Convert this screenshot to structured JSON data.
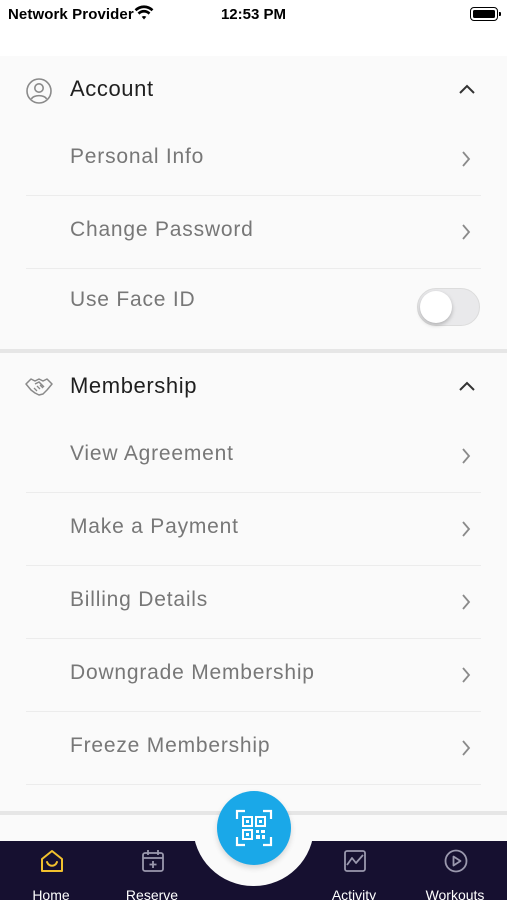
{
  "status_bar": {
    "carrier": "Network Provider",
    "time": "12:53 PM",
    "wifi_icon": "wifi-icon",
    "battery_icon": "battery-icon"
  },
  "account": {
    "title": "Account",
    "icon": "user-circle-icon",
    "collapse_icon": "chevron-up-icon",
    "items": [
      {
        "label": "Personal Info",
        "icon": "chevron-right-icon"
      },
      {
        "label": "Change Password",
        "icon": "chevron-right-icon"
      }
    ],
    "face_id": {
      "label": "Use Face ID",
      "enabled": false
    }
  },
  "membership": {
    "title": "Membership",
    "icon": "handshake-icon",
    "collapse_icon": "chevron-up-icon",
    "items": [
      {
        "label": "View Agreement",
        "icon": "chevron-right-icon"
      },
      {
        "label": "Make a Payment",
        "icon": "chevron-right-icon"
      },
      {
        "label": "Billing Details",
        "icon": "chevron-right-icon"
      },
      {
        "label": "Downgrade Membership",
        "icon": "chevron-right-icon"
      },
      {
        "label": "Freeze Membership",
        "icon": "chevron-right-icon"
      }
    ]
  },
  "tab_bar": {
    "tabs": [
      {
        "label": "Home",
        "icon": "home-icon",
        "active": true
      },
      {
        "label": "Reserve",
        "icon": "calendar-add-icon",
        "active": false
      },
      {
        "label": "Activity",
        "icon": "activity-chart-icon",
        "active": false
      },
      {
        "label": "Workouts",
        "icon": "play-circle-icon",
        "active": false
      }
    ],
    "scan_button_icon": "qr-code-icon"
  },
  "colors": {
    "background": "#fafafa",
    "tab_bar": "#161030",
    "accent": "#1aa8e8",
    "active_tab_icon": "#f2c12e",
    "row_text": "#777777"
  }
}
